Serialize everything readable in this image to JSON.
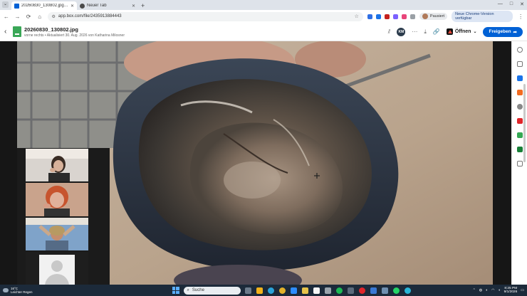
{
  "tabs": [
    {
      "label": "20260830_130802.jpg | Bereitg",
      "active": true,
      "icon_color": "#0061d5"
    },
    {
      "label": "Neuer Tab",
      "active": false,
      "icon_color": "#4a4a4a"
    }
  ],
  "tab_new_glyph": "+",
  "window_controls": {
    "minimize": "—",
    "maximize": "□",
    "close": "✕"
  },
  "address": {
    "url": "app.box.com/file/2435913884443"
  },
  "profile": {
    "label": "Pausiert"
  },
  "update_chip": {
    "label": "Neue Chrome-Version verfügbar"
  },
  "file": {
    "name": "20260830_130802.jpg",
    "meta": "vorne rechts • Aktualisiert 30. Aug. 2026 von Katharina Milosner"
  },
  "header": {
    "user_initials": "KM",
    "open_label": "Öffnen",
    "share_label": "Freigeben"
  },
  "taskbar": {
    "weather_temp": "16°C",
    "weather_desc": "Leichter Regen",
    "search_placeholder": "Suche",
    "time": "8:25 PM",
    "date": "9/1/2026"
  },
  "colors": {
    "accent": "#0061d5",
    "file_icon": "#3aa757",
    "taskbar": "#1c2a3a"
  }
}
